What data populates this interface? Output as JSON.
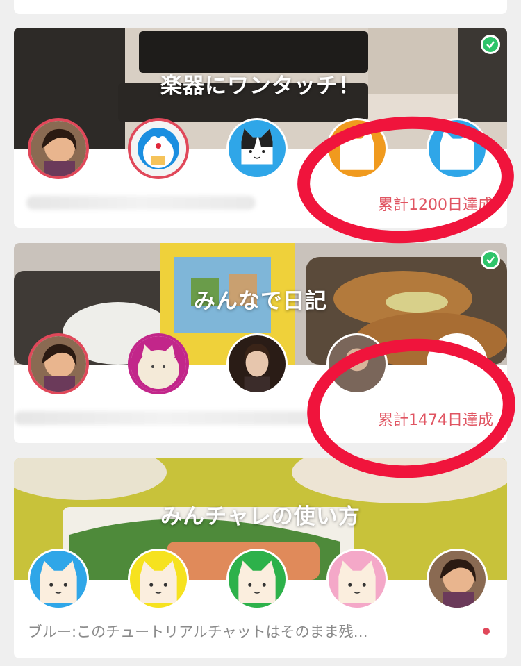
{
  "cards": [
    {
      "title": "楽器にワンタッチ！",
      "completed_icon": "check-circle-icon",
      "members": [
        "girl-photo-avatar",
        "doraemon-avatar",
        "black-cat-avatar",
        "orange-cat-avatar",
        "blue-cat-avatar"
      ],
      "stat": "累計1200日達成"
    },
    {
      "title": "みんなで日記",
      "completed_icon": "check-circle-icon",
      "members": [
        "girl-photo-avatar",
        "fluffy-cat-avatar",
        "portrait-woman-avatar",
        "partial-avatar",
        "white-avatar"
      ],
      "stat": "累計1474日達成"
    },
    {
      "title": "みんチャレの使い方",
      "members": [
        "blue-cat-avatar",
        "yellow-cat-avatar",
        "green-cat-avatar",
        "pink-cat-avatar",
        "girl-photo-avatar"
      ],
      "preview": "ブルー:このチュートリアルチャットはそのまま残…",
      "unread_icon": "unread-dot-icon"
    }
  ],
  "colors": {
    "accent_red": "#e0485a",
    "stat_text": "#e05562",
    "check_green": "#2ec46a",
    "annotation_red": "#f0143c"
  }
}
